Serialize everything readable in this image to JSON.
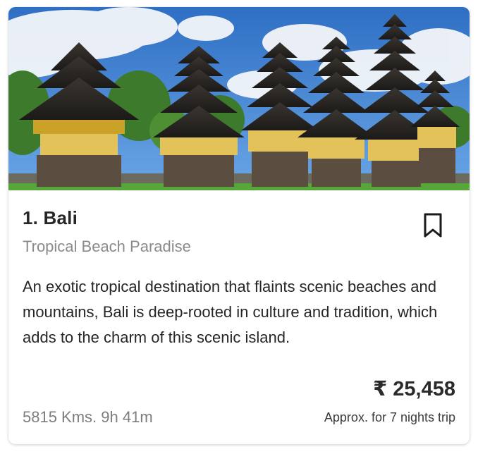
{
  "card": {
    "image_alt": "Bali temple pagodas under blue sky",
    "title": "1. Bali",
    "subtitle": "Tropical Beach Paradise",
    "description": "An exotic tropical destination that flaints scenic beaches and mountains, Bali is deep-rooted in culture and tradition, which adds to the charm of this scenic island.",
    "price": "₹ 25,458",
    "distance": "5815 Kms. 9h 41m",
    "price_note": "Approx. for 7 nights trip",
    "bookmark_icon": "bookmark-outline-icon"
  },
  "colors": {
    "title": "#262626",
    "subtitle": "#8a8a8a",
    "text": "#262626",
    "sky": "#3f86d8"
  }
}
